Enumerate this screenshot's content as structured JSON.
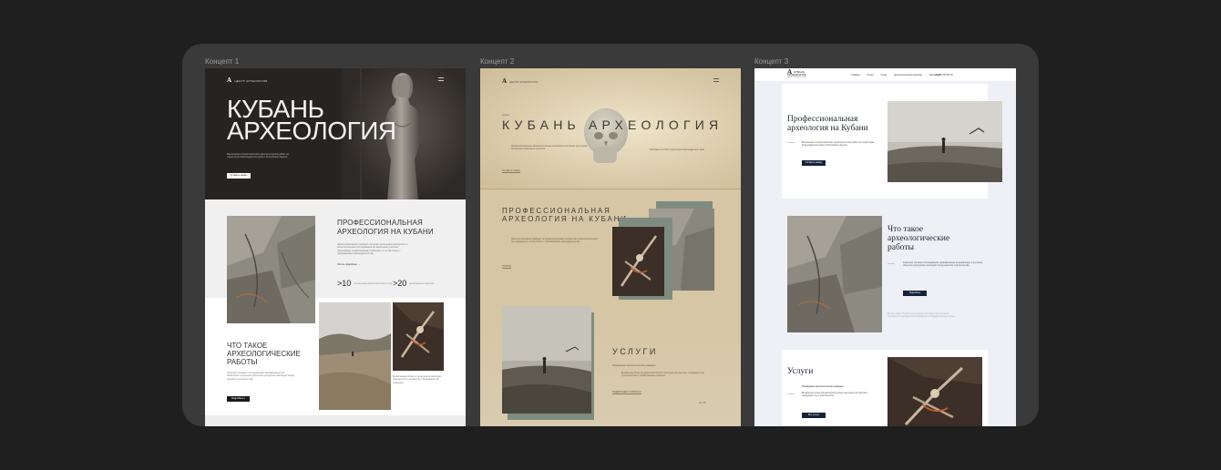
{
  "concepts": [
    {
      "label": "Концепт 1"
    },
    {
      "label": "Концепт 2"
    },
    {
      "label": "Концепт 3"
    }
  ],
  "c1": {
    "logo_mark": "A",
    "logo_text": "ЦЕНТР АРХЕОЛОГИИ",
    "hero_title_1": "КУБАНЬ",
    "hero_title_2": "АРХЕОЛОГИЯ",
    "hero_text": "Выполняем полный комплекс археологических работ на территории Краснодарского края и Республики Адыгея",
    "hero_button": "Оставить заявку",
    "about_title": "ПРОФЕССИОНАЛЬНАЯ АРХЕОЛОГИЯ НА КУБАНИ",
    "about_text": "Наша организация проводит историко-культурные экспертизы и археологические исследования на земельных участках, подлежащих хозяйственному освоению, в соответствии с требованиями законодательства",
    "about_more": "Читать подробнее →",
    "stat1_value": ">10",
    "stat1_label": "лет на рынке археологических услуг",
    "stat2_value": ">20",
    "stat2_label": "выполненных проектов",
    "works_title": "ЧТО ТАКОЕ АРХЕОЛОГИЧЕСКИЕ РАБОТЫ",
    "works_text": "Комплекс полевых исследований, направленных на выявление и изучение объектов культурного наследия перед началом строительства",
    "works_button": "Подробнее о работах",
    "bones_text": "Выявленные объекты культурного наследия фиксируются, изучаются и передаются на хранение"
  },
  "c2": {
    "logo_mark": "A",
    "logo_text": "ЦЕНТР АРХЕОЛОГИИ",
    "hero_pre": "Кубань",
    "hero_title": "КУБАНЬ АРХЕОЛОГИЯ",
    "hero_text_1": "Профессиональные археологические изыскания и историко-культурная экспертиза земельных участков",
    "hero_text_2": "Работаем на всей территории Краснодарского края",
    "hero_link": "Оставить заявку",
    "about_title": "ПРОФЕССИОНАЛЬНАЯ АРХЕОЛОГИЯ НА КУБАНИ",
    "about_text": "Наша организация проводит историко-культурные экспертизы и археологические исследования в соответствии с требованиями законодательства",
    "about_link": "УСЛУГИ",
    "services_title": "УСЛУГИ",
    "services_sub": "Проведение археологических разведок",
    "services_text": "Выявление объектов археологического наследия на участках, отводимых под строительство и хозяйственное освоение",
    "services_link": "ПОДРОБНЕЕ О РАБОТАХ",
    "pager": "01 / 06"
  },
  "c3": {
    "logo_mark": "A",
    "logo_text": "КУБАНЬ АРХЕОЛОГИЯ",
    "logo_sub": "ЦЕНТР АРХЕОЛОГИИ",
    "nav": [
      "Главная",
      "Услуги",
      "О нас",
      "Археологические раскопки",
      "Контакты"
    ],
    "phone": "8 988 378 95 76",
    "hero_title": "Профессиональная археология на Кубани",
    "hero_text": "Выполняем полный комплекс археологических работ на территории Краснодарского края и Республики Адыгея",
    "hero_button": "Оставить заявку",
    "works_title": "Что такое археологические работы",
    "works_text": "Комплекс полевых исследований, направленных на выявление и изучение объектов культурного наследия перед началом строительства",
    "works_button": "Подробнее",
    "works_note": "Выявленные объекты культурного наследия фиксируются, изучаются и передаются на хранение в государственные музеи",
    "services_title": "Услуги",
    "services_sub": "Проведение археологических разведок",
    "services_text": "Выявление объектов археологического наследия на участках, отводимых под строительство",
    "services_button": "Все услуги"
  }
}
